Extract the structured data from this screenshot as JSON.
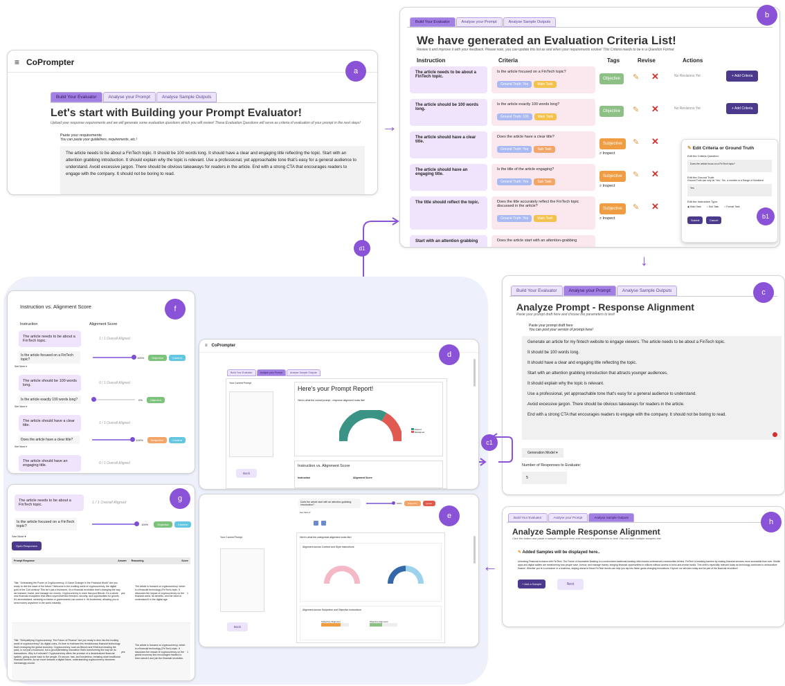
{
  "badges": {
    "a": "a",
    "b": "b",
    "b1": "b1",
    "c": "c",
    "c1": "c1",
    "d": "d",
    "d1": "d1",
    "e": "e",
    "f": "f",
    "g": "g",
    "h": "h"
  },
  "tabs": {
    "build": "Build Your Evaluator",
    "analyse": "Analyse your Prompt",
    "samples": "Analyse Sample Outputs"
  },
  "panel_a": {
    "menu_icon": "≡",
    "app_title": "CoPrompter",
    "heading": "Let's start with Building your Prompt Evaluator!",
    "subtitle": "Upload your response requirements and we will generate some evaluation questions which you will review! These Evaluation Questions will serve as criteria of evaluation of your prompt in the next steps!",
    "paste_label": "Paste your requirements",
    "paste_hint": "You can paste your guidelines, requirements, etc.!",
    "requirements": "The article needs to be about a FinTech topic. It should be 100 words long. It should have a clear and engaging title reflecting the topic. Start with an attention grabbing introduction. It should explain why the topic is relevant. Use a professional, yet approachable tone that's easy for a general audience to understand. Avoid excessive jargon. There should be obvious takeaways for readers in the article. End with a strong CTA that encourages readers to engage with the company. It should not be boring to read."
  },
  "panel_b": {
    "heading": "We have generated an Evaluation Criteria List!",
    "subtitle": "Review it and improve it with your feedback. Please note, you can update this list as and when your requirements evolve! This Criteria needs to be in a Question Format",
    "columns": [
      "Instruction",
      "Criteria",
      "Tags",
      "Revise",
      "Actions"
    ],
    "rows": [
      {
        "instruction": "The article needs to be about a FinTech topic.",
        "criteria": "Is the article focused on a FinTech topic?",
        "gt": "Ground Truth: Yes",
        "task": "Main Task",
        "tag": "Objective",
        "status": "No Revisions Yet",
        "btn": "+ Add Criteria"
      },
      {
        "instruction": "The article should be 100 words long.",
        "criteria": "Is the article exactly 100 words long?",
        "gt": "Ground Truth: 100",
        "task": "Main Task",
        "tag": "Objective",
        "status": "No Revisions Yet",
        "btn": "+ Add Criteria"
      },
      {
        "instruction": "The article should have a clear title.",
        "criteria": "Does the article have a clear title?",
        "gt": "Ground Truth: Yes",
        "task": "Sub Task",
        "tag": "Subjective",
        "inspect": "Inspect"
      },
      {
        "instruction": "The article should have an engaging title.",
        "criteria": "Is the title of the article engaging?",
        "gt": "Ground Truth: Yes",
        "task": "Sub Task",
        "tag": "Subjective",
        "inspect": "Inspect"
      },
      {
        "instruction": "The title should reflect the topic.",
        "criteria": "Does the title accurately reflect the FinTech topic discussed in the article?",
        "gt": "Ground Truth: Yes",
        "task": "Main Task",
        "tag": "Subjective",
        "inspect": "Inspect"
      },
      {
        "instruction": "Start with an attention grabbing",
        "criteria": "Does the article start with an attention-grabbing"
      }
    ],
    "edit": {
      "title": "Edit Criteria or Ground Truth",
      "q_label": "Edit the Criteria Question:",
      "q_value": "Does the article focus on a FinTech topic?",
      "gt_label": "Edit the Ground Truth:",
      "gt_hint": "Ground Truth can only be 'Yes', 'No', a number or a Range of Numbers!",
      "gt_value": "Yes",
      "type_label": "Edit the Instruction Type:",
      "types": [
        "Main Task",
        "Sub Task",
        "Format Task"
      ],
      "submit": "Submit",
      "cancel": "Cancel"
    }
  },
  "panel_c": {
    "heading": "Analyze Prompt - Response Alignment",
    "subtitle": "Paste your prompt draft here and choose the parameters to test!",
    "paste_label": "Paste your prompt draft here",
    "paste_hint": "You can post your version of prompt here!",
    "prompt_lines": [
      "Generate an article for my fintech website to engage viewers. The article needs to be about a FinTech topic.",
      "It should be 100 words long.",
      "It should have a clear and engaging title reflecting the topic.",
      "Start with an attention grabbing introduction that attracts younger audiences.",
      "It should explain why the topic is relevant.",
      "Use a professional, yet approachable tone that's easy for a general audience to understand.",
      "Avoid excessive jargon. There should be obvious takeaways for readers in the article.",
      "End with a strong CTA that encourages readers to engage with the company. It should not be boring to read."
    ],
    "model": "Generation Model",
    "responses_label": "Number of Responses to Evaluate:",
    "responses_value": "5"
  },
  "panel_d": {
    "app_title": "CoPrompter",
    "prompt_label": "Your Current Prompt",
    "report": "Here's your Prompt Report!",
    "chart_note": "Here's what the overall prompt - response alignment looks like!",
    "legend_a": "Aligned",
    "legend_b": "Misaligned",
    "back": "Back",
    "score_title": "Instruction vs. Alignment Score",
    "col1": "Instruction",
    "col2": "Alignment Score"
  },
  "panel_e": {
    "top_q": "Does the article start with an attention-grabbing introduction?",
    "pct": "100%",
    "tag_sub": "Subjective",
    "tag_red": "Ignore",
    "see_more": "See More",
    "prompt_label": "Your Current Prompt",
    "chart_note": "Here's what the categorical alignment looks like!",
    "sec1": "Alignment across Content and Style Instructions",
    "sec2": "Alignment across Subjective and Objective instructions",
    "sub_label": "Subjective Alignment",
    "obj_label": "Objective Alignment",
    "back": "Back"
  },
  "panel_f": {
    "title": "Instruction vs. Alignment Score",
    "col1": "Instruction",
    "col2": "Alignment Score",
    "rows": [
      {
        "instruction": "The article needs to be about a FinTech topic.",
        "overall": "1 / 1 Overall Aligned",
        "q": "Is the article focused on a FinTech topic?",
        "pct": "100%",
        "tag": "Objective",
        "tag2": "Content",
        "fill": 1.0
      },
      {
        "instruction": "The article should be 100 words long.",
        "overall": "0 / 1 Overall Aligned",
        "q": "Is the article exactly 100 words long?",
        "pct": "0%",
        "tag": "Objective",
        "fill": 0
      },
      {
        "instruction": "The article should have a clear title.",
        "overall": "1 / 1 Overall Aligned",
        "q": "Does the article have a clear title?",
        "pct": "100%",
        "tag": "Subjective",
        "tag2": "Content",
        "fill": 1.0
      },
      {
        "instruction": "The article should have an engaging title.",
        "overall": "0 / 1 Overall Aligned"
      }
    ],
    "see_more": "See More"
  },
  "panel_g": {
    "instruction": "The article needs to be about a FinTech topic.",
    "overall": "1 / 1 Overall Aligned",
    "q": "Is the article focused on a FinTech topic?",
    "pct": "100%",
    "tag": "Objective",
    "tag2": "Content",
    "see_more": "See More",
    "open": "Open Responses",
    "cols": [
      "Prompt Response",
      "Answer",
      "Reasoning",
      "Score"
    ],
    "rows": [
      {
        "resp": "Title: \"Unleashing the Power of Cryptocurrency: A Game Changer in the Financial World\" Are you ready to ride the wave of the future? Welcome to the exciting world of cryptocurrency, the digital gold of the 21st century! This isn't just a buzzword, it's a financial revolution that's changing the way we transact, invest, and manage our money. Cryptocurrency is more than just Bitcoin. It's a whole new financial ecosystem that offers unprecedented freedom, security, and opportunities for growth. It's decentralized, meaning no banks or governments can control it. It's borderless, allowing you to send money anywhere in the world instantly.",
        "answer": "yes",
        "reason": "The article is focused on cryptocurrency, which is a financial technology (FinTech) topic. It discusses the impact of cryptocurrency on the financial world, its benefits, and the need to understand it in the digital age.",
        "score": "1"
      },
      {
        "resp": "Title: \"Demystifying Cryptocurrency: The Future of Finance\" Are you ready to dive into the exciting world of cryptocurrency? As digital coins, it's time to embrace this revolutionary financial technology that's reshaping the global economy. Cryptocurrency, such as Bitcoin and Ethereum leading the pack, is not just a buzzword, but a groundbreaking innovation that's transforming the way we do transactions. Why is it relevant? Cryptocurrency offers the promise of a decentralized financial system, giving power back to the people. It's secure, fast, and borderless, breaking down traditional financial barriers. As we move towards a digital future, understanding cryptocurrency becomes increasingly crucial.",
        "answer": "yes",
        "reason": "The article is focused on cryptocurrency, which is a financial technology (FinTech) topic. It discusses the impact of cryptocurrency on the global economy and encourages readers to learn about it and join the financial revolution.",
        "score": "1"
      }
    ]
  },
  "panel_h": {
    "heading": "Analyze Sample Response Alignment",
    "subtitle": "Click the button and paste a sample response here and choose the parameters to test! You can add multiple samples too!",
    "added": "Added Samples will be displayed here..",
    "sample": "Unlocking Financial Inclusion with FinTech: The Future of Accessible Banking In a world where traditional banking often leaves underserved communities behind, FinTech is breaking barriers by making financial services more accessible than ever. Mobile apps and digital wallets are transforming how people save, borrow, and manage money, bringing financial opportunities to millions without access to brick-and-mortar banks. This shift is especially relevant today as technology continues to democratize finance. Whether you're a consumer or a business, staying ahead of these FinTech trends can help you tap into these game-changing innovations. Explore our services today and be part of the financial revolution!",
    "add": "+ Add a Sample",
    "next": "Next"
  }
}
